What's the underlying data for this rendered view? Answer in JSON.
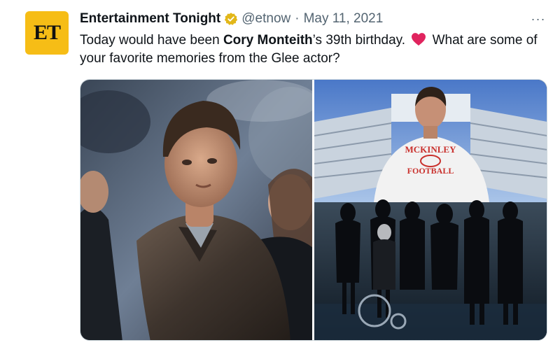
{
  "account": {
    "avatar_text": "ET",
    "avatar_color": "#f6bd16",
    "name": "Entertainment Tonight",
    "verified_icon": "verified-badge-gold",
    "handle": "@etnow",
    "separator": "·",
    "date": "May 11, 2021"
  },
  "tweet": {
    "text_part1": "Today would have been ",
    "text_bold": "Cory Monteith",
    "text_part2": "’s 39th birthday.",
    "emoji": "red-heart",
    "text_part3": "What are some of your favorite memories from the Glee actor?"
  },
  "media": {
    "photo1_icon": "photo-man-leather-jacket",
    "photo2_icon": "photo-stage-tribute",
    "shirt_line1": "MCKINLEY",
    "shirt_line2": "FOOTBALL"
  },
  "menu": {
    "more_label": "···"
  },
  "colors": {
    "text": "#0f1419",
    "muted": "#536471",
    "heart": "#e0245e",
    "verified": "#e2b719"
  }
}
